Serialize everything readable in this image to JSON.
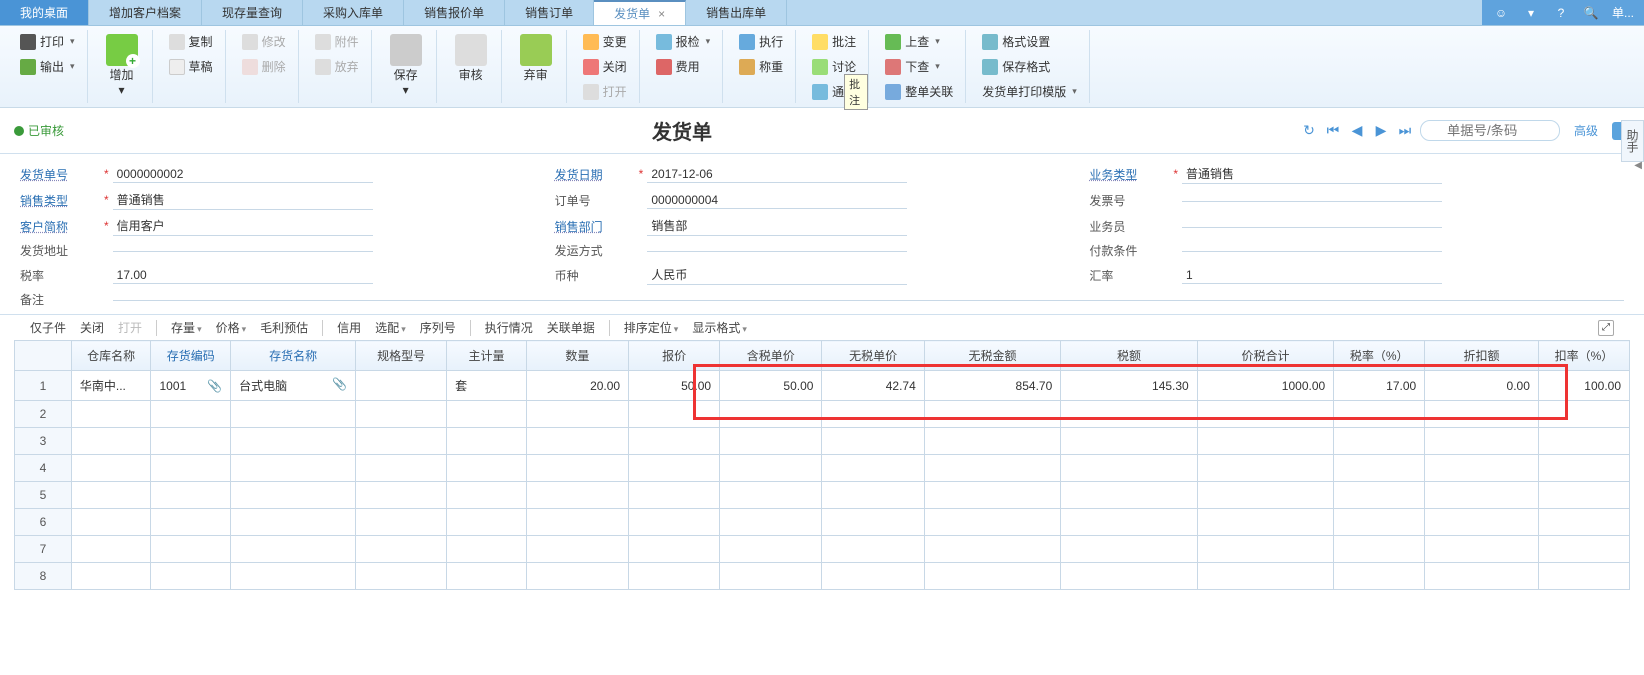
{
  "tabs": {
    "my": "我的桌面",
    "items": [
      "增加客户档案",
      "现存量查询",
      "采购入库单",
      "销售报价单",
      "销售订单",
      "发货单",
      "销售出库单"
    ],
    "active": "发货单"
  },
  "topSearchPlaceholder": "单...",
  "ribbon": {
    "print": "打印",
    "export": "输出",
    "add": "增加",
    "copy": "复制",
    "draft": "草稿",
    "modify": "修改",
    "delete": "删除",
    "attach": "附件",
    "discard": "放弃",
    "save": "保存",
    "audit": "审核",
    "abandon": "弃审",
    "change": "变更",
    "close": "关闭",
    "open": "打开",
    "inspect": "报检",
    "execute": "执行",
    "fee": "费用",
    "weigh": "称重",
    "annotate": "批注",
    "discuss": "讨论",
    "notify": "通知",
    "tooltip": "批注",
    "up": "上查",
    "down": "下查",
    "whole": "整单关联",
    "format": "格式设置",
    "saveformat": "保存格式",
    "template": "发货单打印模版"
  },
  "titlebar": {
    "status": "已审核",
    "title": "发货单",
    "searchPlaceholder": "单据号/条码",
    "advanced": "高级"
  },
  "form": {
    "shipNo": {
      "label": "发货单号",
      "value": "0000000002"
    },
    "saleType": {
      "label": "销售类型",
      "value": "普通销售"
    },
    "custAbbr": {
      "label": "客户简称",
      "value": "信用客户"
    },
    "shipAddr": {
      "label": "发货地址",
      "value": ""
    },
    "taxRate": {
      "label": "税率",
      "value": "17.00"
    },
    "remark": {
      "label": "备注",
      "value": ""
    },
    "shipDate": {
      "label": "发货日期",
      "value": "2017-12-06"
    },
    "orderNo": {
      "label": "订单号",
      "value": "0000000004"
    },
    "saleDept": {
      "label": "销售部门",
      "value": "销售部"
    },
    "shipMode": {
      "label": "发运方式",
      "value": ""
    },
    "currency": {
      "label": "币种",
      "value": "人民币"
    },
    "bizType": {
      "label": "业务类型",
      "value": "普通销售"
    },
    "invoiceNo": {
      "label": "发票号",
      "value": ""
    },
    "salesman": {
      "label": "业务员",
      "value": ""
    },
    "payTerm": {
      "label": "付款条件",
      "value": ""
    },
    "exRate": {
      "label": "汇率",
      "value": "1"
    }
  },
  "subtoolbar": {
    "only": "仅子件",
    "close": "关闭",
    "open": "打开",
    "stock": "存量",
    "price": "价格",
    "gross": "毛利预估",
    "credit": "信用",
    "match": "选配",
    "serial": "序列号",
    "exec": "执行情况",
    "rel": "关联单据",
    "sort": "排序定位",
    "disp": "显示格式"
  },
  "grid": {
    "headers": {
      "wh": "仓库名称",
      "code": "存货编码",
      "name": "存货名称",
      "spec": "规格型号",
      "uom": "主计量",
      "qty": "数量",
      "quote": "报价",
      "taxPrice": "含税单价",
      "noTaxPrice": "无税单价",
      "noTaxAmt": "无税金额",
      "tax": "税额",
      "total": "价税合计",
      "taxRate": "税率（%）",
      "disc": "折扣额",
      "discRate": "扣率（%）"
    },
    "rows": [
      {
        "n": "1",
        "wh": "华南中...",
        "code": "1001",
        "name": "台式电脑",
        "spec": "",
        "uom": "套",
        "qty": "20.00",
        "quote": "50.00",
        "taxPrice": "50.00",
        "noTaxPrice": "42.74",
        "noTaxAmt": "854.70",
        "tax": "145.30",
        "total": "1000.00",
        "taxRate": "17.00",
        "disc": "0.00",
        "discRate": "100.00"
      }
    ]
  },
  "help": "助手"
}
